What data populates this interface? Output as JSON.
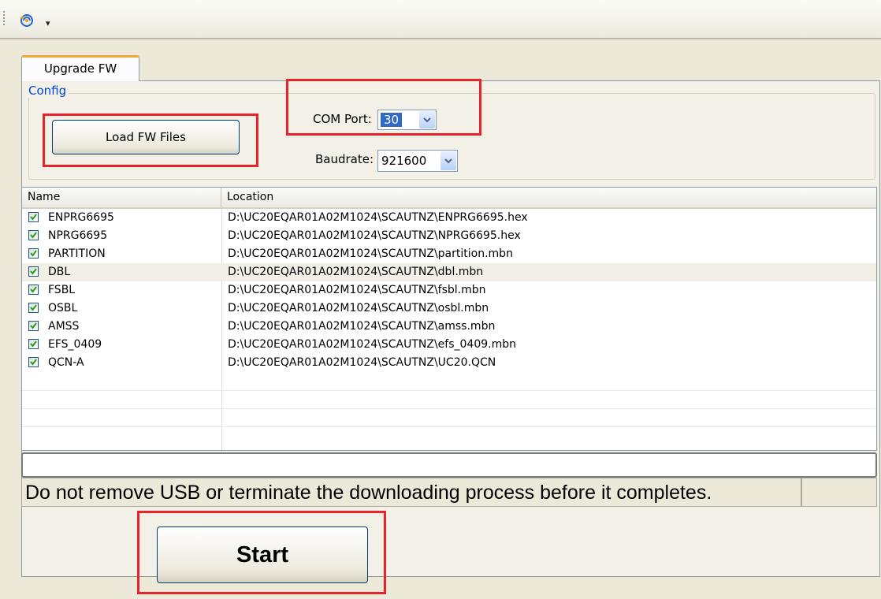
{
  "toolbar": {
    "button_icon": "app-menu-icon",
    "dropdown_icon": "chevron-down-icon"
  },
  "tabs": [
    {
      "label": "Upgrade FW",
      "selected": true
    }
  ],
  "config": {
    "legend": "Config",
    "load_button": "Load FW Files",
    "com_port_label": "COM Port:",
    "com_port_value": "30",
    "baudrate_label": "Baudrate:",
    "baudrate_value": "921600"
  },
  "file_list": {
    "columns": [
      "Name",
      "Location"
    ],
    "rows": [
      {
        "name": "ENPRG6695",
        "location": "D:\\UC20EQAR01A02M1024\\SCAUTNZ\\ENPRG6695.hex",
        "checked": true
      },
      {
        "name": "NPRG6695",
        "location": "D:\\UC20EQAR01A02M1024\\SCAUTNZ\\NPRG6695.hex",
        "checked": true
      },
      {
        "name": "PARTITION",
        "location": "D:\\UC20EQAR01A02M1024\\SCAUTNZ\\partition.mbn",
        "checked": true
      },
      {
        "name": "DBL",
        "location": "D:\\UC20EQAR01A02M1024\\SCAUTNZ\\dbl.mbn",
        "checked": true
      },
      {
        "name": "FSBL",
        "location": "D:\\UC20EQAR01A02M1024\\SCAUTNZ\\fsbl.mbn",
        "checked": true
      },
      {
        "name": "OSBL",
        "location": "D:\\UC20EQAR01A02M1024\\SCAUTNZ\\osbl.mbn",
        "checked": true
      },
      {
        "name": "AMSS",
        "location": "D:\\UC20EQAR01A02M1024\\SCAUTNZ\\amss.mbn",
        "checked": true
      },
      {
        "name": "EFS_0409",
        "location": "D:\\UC20EQAR01A02M1024\\SCAUTNZ\\efs_0409.mbn",
        "checked": true
      },
      {
        "name": "QCN-A",
        "location": "D:\\UC20EQAR01A02M1024\\SCAUTNZ\\UC20.QCN",
        "checked": true
      }
    ]
  },
  "status": {
    "message": "Do not remove USB or terminate the downloading process before it completes.",
    "progress": 0
  },
  "start_button": "Start",
  "colors": {
    "highlight": "#e8232a",
    "selection": "#316ac5",
    "legend": "#0046d5"
  }
}
